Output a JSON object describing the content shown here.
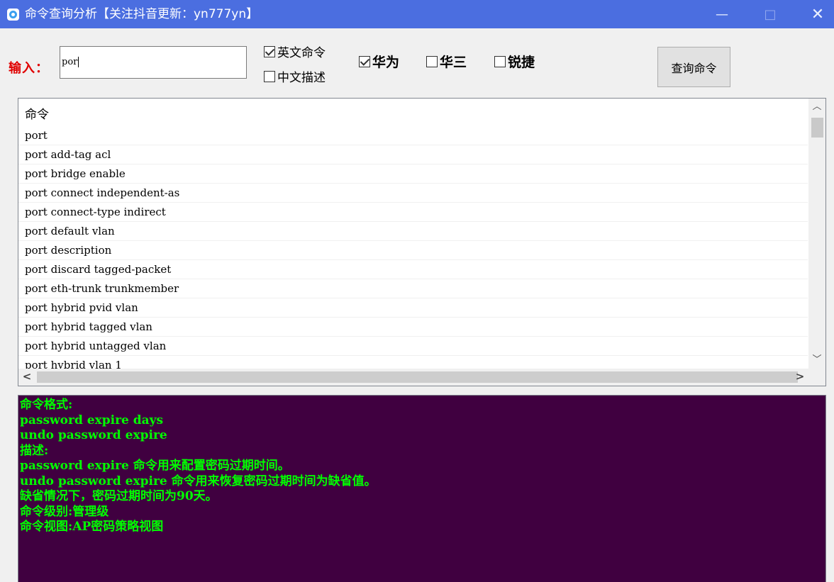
{
  "window": {
    "title": "命令查询分析【关注抖音更新：yn777yn】",
    "minimize": "—",
    "maximize": "□",
    "close": "✕"
  },
  "toolbar": {
    "input_label": "输入：",
    "search_value": "por",
    "options": {
      "english_command": {
        "label": "英文命令",
        "checked": true
      },
      "chinese_desc": {
        "label": "中文描述",
        "checked": false
      }
    },
    "vendors": {
      "huawei": {
        "label": "华为",
        "checked": true
      },
      "h3c": {
        "label": "华三",
        "checked": false
      },
      "ruijie": {
        "label": "锐捷",
        "checked": false
      }
    },
    "query_button": "查询命令"
  },
  "list": {
    "header": "命令",
    "rows": [
      "port",
      "port add-tag acl",
      "port bridge enable",
      "port connect independent-as",
      "port connect-type indirect",
      "port default vlan",
      "port description",
      "port discard tagged-packet",
      "port eth-trunk trunkmember",
      "port hybrid pvid vlan",
      "port hybrid tagged vlan",
      "port hybrid untagged vlan",
      "port hybrid vlan 1"
    ]
  },
  "detail": {
    "lines": [
      "命令格式:",
      "password expire days",
      "undo password expire",
      "描述:",
      "password expire 命令用来配置密码过期时间。",
      "undo password expire 命令用来恢复密码过期时间为缺省值。",
      "缺省情况下，密码过期时间为90天。",
      "命令级别:管理级",
      "命令视图:AP密码策略视图"
    ]
  },
  "colors": {
    "titlebar": "#4b6ee0",
    "label_red": "#e00000",
    "terminal_bg": "#400040",
    "terminal_text": "#00ff00"
  }
}
